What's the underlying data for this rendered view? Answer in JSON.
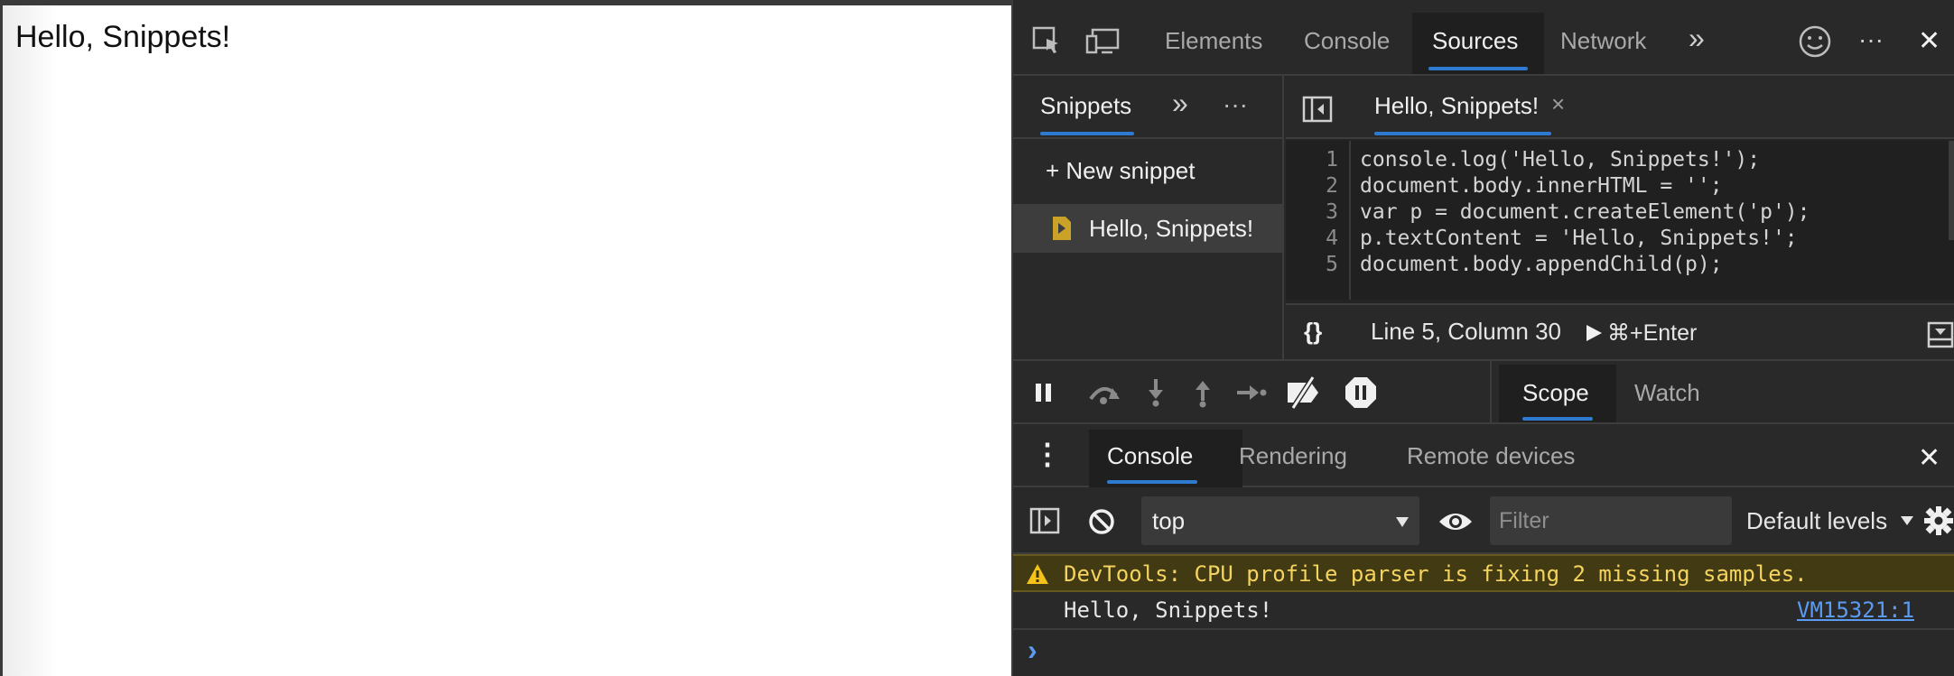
{
  "page": {
    "text": "Hello, Snippets!"
  },
  "devtools": {
    "main_tabs": [
      {
        "label": "Elements"
      },
      {
        "label": "Console"
      },
      {
        "label": "Sources"
      },
      {
        "label": "Network"
      }
    ],
    "more_tabs_glyph": "»",
    "more_menu_glyph": "···",
    "close_glyph": "✕",
    "icons": [
      "inspect-icon",
      "device-toolbar-icon",
      "feedback-smiley-icon",
      "more-menu-icon",
      "close-icon"
    ],
    "sources": {
      "nav_tab": "Snippets",
      "nav_more_glyph": "»",
      "nav_menu_glyph": "···",
      "new_snippet": "+ New snippet",
      "snippets": [
        {
          "name": "Hello, Snippets!"
        }
      ],
      "editor_tab": {
        "label": "Hello, Snippets!",
        "close": "×"
      },
      "code": {
        "line_numbers": [
          "1",
          "2",
          "3",
          "4",
          "5"
        ],
        "lines": [
          "console.log('Hello, Snippets!');",
          "document.body.innerHTML = '';",
          "var p = document.createElement('p');",
          "p.textContent = 'Hello, Snippets!';",
          "document.body.appendChild(p);"
        ]
      },
      "status": {
        "format_glyph": "{}",
        "position": "Line 5, Column 30",
        "run_label": "⌘+Enter"
      }
    },
    "debugger": {
      "side_tabs": [
        {
          "label": "Scope"
        },
        {
          "label": "Watch"
        }
      ],
      "icons": [
        "pause-icon",
        "step-over-icon",
        "step-into-icon",
        "step-out-icon",
        "step-icon",
        "deactivate-breakpoints-icon",
        "pause-on-exceptions-icon"
      ]
    },
    "drawer": {
      "menu_glyph": "⋮",
      "tabs": [
        {
          "label": "Console"
        },
        {
          "label": "Rendering"
        },
        {
          "label": "Remote devices"
        }
      ],
      "close_glyph": "✕",
      "console_toolbar": {
        "context": "top",
        "filter_placeholder": "Filter",
        "levels": "Default levels"
      },
      "messages": {
        "warning": "DevTools: CPU profile parser is fixing 2 missing samples.",
        "log": "Hello, Snippets!",
        "log_source": "VM15321:1"
      },
      "prompt_glyph": "›"
    },
    "colors": {
      "accent": "#2f7ad1",
      "warning_bg": "#413a12",
      "warning_text": "#f4d35e",
      "link": "#5b9cf2"
    }
  }
}
